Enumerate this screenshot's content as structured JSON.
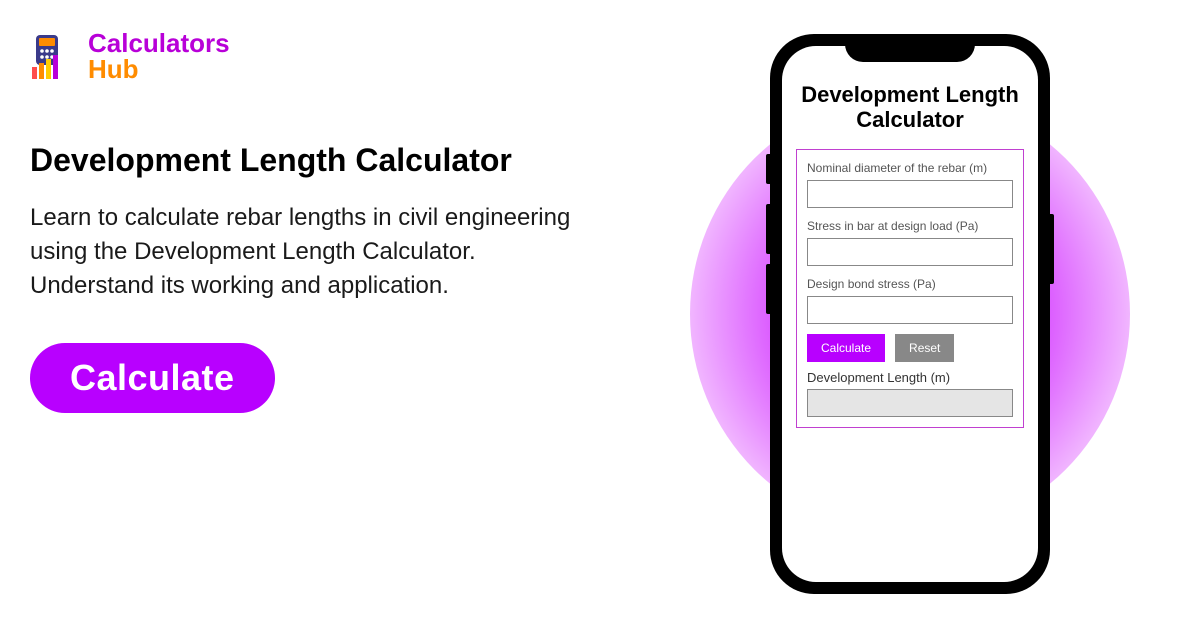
{
  "logo": {
    "text_top": "Calculators",
    "text_bottom": "Hub"
  },
  "main": {
    "heading": "Development Length Calculator",
    "description": "Learn to calculate rebar lengths in civil engineering using the Development Length Calculator. Understand its working and application.",
    "cta_label": "Calculate"
  },
  "phone": {
    "title": "Development Length Calculator",
    "form": {
      "field1_label": "Nominal diameter of the rebar (m)",
      "field2_label": "Stress in bar at design load (Pa)",
      "field3_label": "Design bond stress (Pa)",
      "calc_button": "Calculate",
      "reset_button": "Reset",
      "result_label": "Development Length (m)"
    }
  },
  "colors": {
    "accent": "#b800ff",
    "gray": "#888888"
  }
}
